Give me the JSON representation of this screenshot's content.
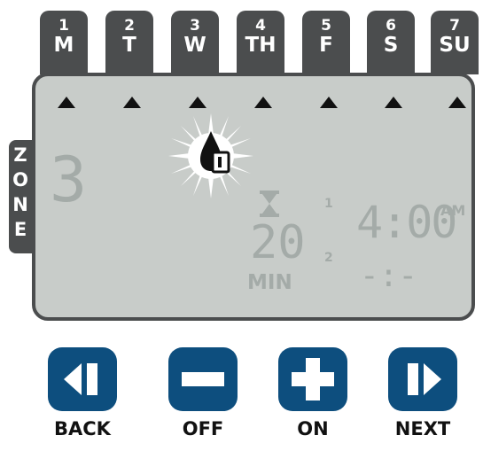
{
  "days": [
    {
      "num": "1",
      "abbr": "M"
    },
    {
      "num": "2",
      "abbr": "T"
    },
    {
      "num": "3",
      "abbr": "W"
    },
    {
      "num": "4",
      "abbr": "TH"
    },
    {
      "num": "5",
      "abbr": "F"
    },
    {
      "num": "6",
      "abbr": "S"
    },
    {
      "num": "7",
      "abbr": "SU"
    }
  ],
  "zone": {
    "letters": [
      "Z",
      "O",
      "N",
      "E"
    ],
    "value": "3"
  },
  "display": {
    "duration_value": "20",
    "duration_unit": "MIN",
    "start_index_1": "1",
    "start_index_2": "2",
    "start_time_1": "4:00",
    "start_time_1_suffix": "AM",
    "start_time_2": "-:-"
  },
  "buttons": [
    {
      "label": "BACK",
      "icon": "back-icon"
    },
    {
      "label": "OFF",
      "icon": "minus-icon"
    },
    {
      "label": "ON",
      "icon": "plus-icon"
    },
    {
      "label": "NEXT",
      "icon": "next-icon"
    }
  ],
  "colors": {
    "tab": "#4b4d4e",
    "lcd": "#c8ccc9",
    "segment_dim": "#a4aba8",
    "button": "#0d4e7e"
  }
}
